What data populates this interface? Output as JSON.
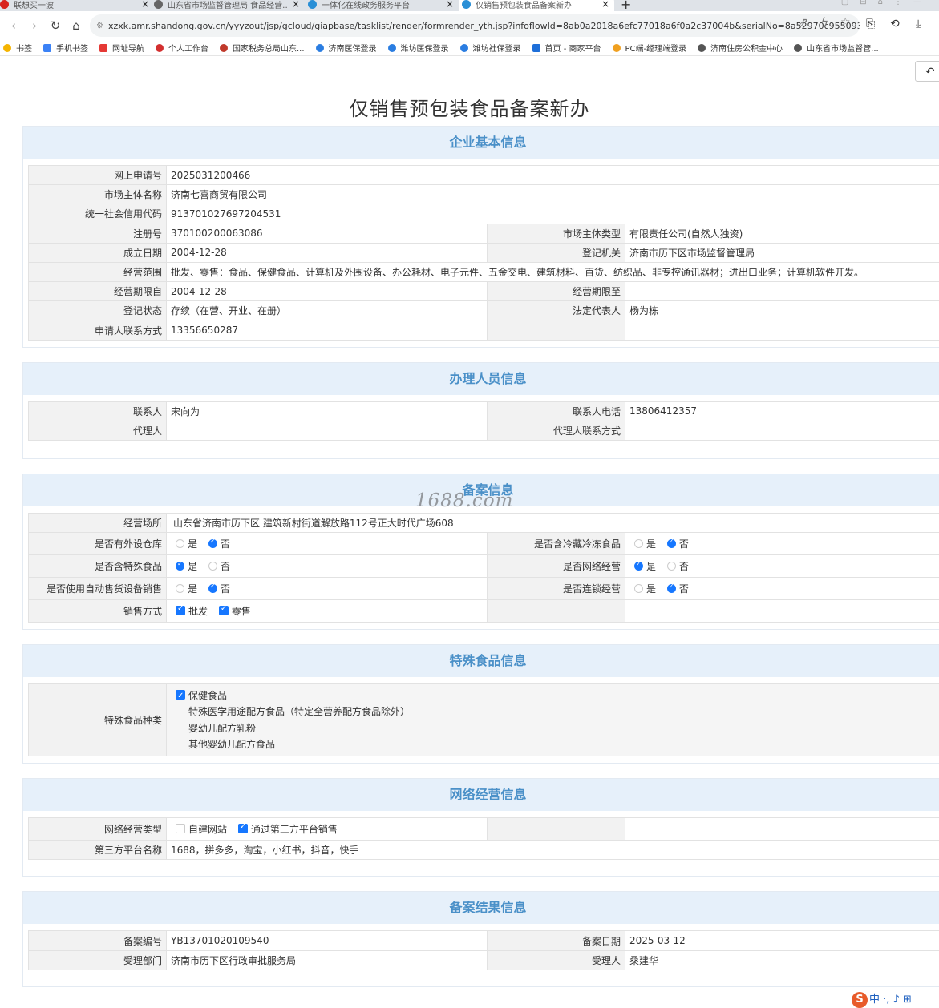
{
  "browser": {
    "tabs": [
      {
        "title": "联想买一波",
        "fav": "#d8231e"
      },
      {
        "title": "山东省市场监督管理局 食品经营…",
        "fav": "#666"
      },
      {
        "title": "一体化在线政务服务平台",
        "fav": "#2a8fd6"
      },
      {
        "title": "仅销售预包装食品备案新办",
        "fav": "#2a8fd6"
      }
    ],
    "new_tab": "+",
    "url": "xzxk.amr.shandong.gov.cn/yyyzout/jsp/gcloud/giapbase/tasklist/render/formrender_yth.jsp?infoflowId=8ab0a2018a6efc77018a6f0a2c37004b&serialNo=8a52970c955093460195885...",
    "bookmarks": [
      {
        "label": "书签",
        "color": "#f5b400"
      },
      {
        "label": "手机书签",
        "color": "#3b82f6"
      },
      {
        "label": "网址导航",
        "color": "#e53935"
      },
      {
        "label": "个人工作台",
        "color": "#d32f2f"
      },
      {
        "label": "国家税务总局山东...",
        "color": "#c0392b"
      },
      {
        "label": "济南医保登录",
        "color": "#2a7de1"
      },
      {
        "label": "潍坊医保登录",
        "color": "#2a7de1"
      },
      {
        "label": "潍坊社保登录",
        "color": "#2a7de1"
      },
      {
        "label": "首页 - 商家平台",
        "color": "#1e6fd9"
      },
      {
        "label": "PC端-经理端登录",
        "color": "#f0a020"
      },
      {
        "label": "济南住房公积金中心",
        "color": "#555"
      },
      {
        "label": "山东省市场监督管...",
        "color": "#555"
      }
    ]
  },
  "page": {
    "title": "仅销售预包装食品备案新办",
    "back_icon": "↶"
  },
  "sections": {
    "basic": {
      "title": "企业基本信息",
      "apply_no_label": "网上申请号",
      "apply_no": "2025031200466",
      "entity_name_label": "市场主体名称",
      "entity_name": "济南七喜商贸有限公司",
      "credit_code_label": "统一社会信用代码",
      "credit_code": "913701027697204531",
      "reg_no_label": "注册号",
      "reg_no": "370100200063086",
      "entity_type_label": "市场主体类型",
      "entity_type": "有限责任公司(自然人独资)",
      "found_date_label": "成立日期",
      "found_date": "2004-12-28",
      "reg_authority_label": "登记机关",
      "reg_authority": "济南市历下区市场监督管理局",
      "scope_label": "经营范围",
      "scope": "批发、零售：食品、保健食品、计算机及外围设备、办公耗材、电子元件、五金交电、建筑材料、百货、纺织品、非专控通讯器材；进出口业务；计算机软件开发。",
      "period_from_label": "经营期限自",
      "period_from": "2004-12-28",
      "period_to_label": "经营期限至",
      "period_to": "",
      "status_label": "登记状态",
      "status": "存续（在营、开业、在册）",
      "legal_rep_label": "法定代表人",
      "legal_rep": "杨为栋",
      "applicant_contact_label": "申请人联系方式",
      "applicant_contact": "13356650287"
    },
    "handler": {
      "title": "办理人员信息",
      "contact_label": "联系人",
      "contact": "宋向为",
      "contact_phone_label": "联系人电话",
      "contact_phone": "13806412357",
      "agent_label": "代理人",
      "agent": "",
      "agent_contact_label": "代理人联系方式",
      "agent_contact": ""
    },
    "filing": {
      "title": "备案信息",
      "place_label": "经营场所",
      "place": "山东省济南市历下区 建筑新村街道解放路112号正大时代广场608",
      "yes": "是",
      "no": "否",
      "warehouse_label": "是否有外设仓库",
      "cold_label": "是否含冷藏冷冻食品",
      "special_label": "是否含特殊食品",
      "online_label": "是否网络经营",
      "vending_label": "是否使用自动售货设备销售",
      "chain_label": "是否连锁经营",
      "sale_mode_label": "销售方式",
      "wholesale": "批发",
      "retail": "零售"
    },
    "special_food": {
      "title": "特殊食品信息",
      "kind_label": "特殊食品种类",
      "options": [
        "保健食品",
        "特殊医学用途配方食品（特定全营养配方食品除外）",
        "婴幼儿配方乳粉",
        "其他婴幼儿配方食品"
      ]
    },
    "online": {
      "title": "网络经营信息",
      "type_label": "网络经营类型",
      "self_site": "自建网站",
      "third_party": "通过第三方平台销售",
      "platform_label": "第三方平台名称",
      "platforms": "1688，拼多多，淘宝，小红书，抖音，快手"
    },
    "result": {
      "title": "备案结果信息",
      "record_no_label": "备案编号",
      "record_no": "YB13701020109540",
      "record_date_label": "备案日期",
      "record_date": "2025-03-12",
      "dept_label": "受理部门",
      "dept": "济南市历下区行政审批服务局",
      "acceptor_label": "受理人",
      "acceptor": "桑建华"
    }
  },
  "watermark": "1688.com",
  "ime": {
    "logo": "S",
    "text": "中 ·, ♪ ⊞"
  }
}
